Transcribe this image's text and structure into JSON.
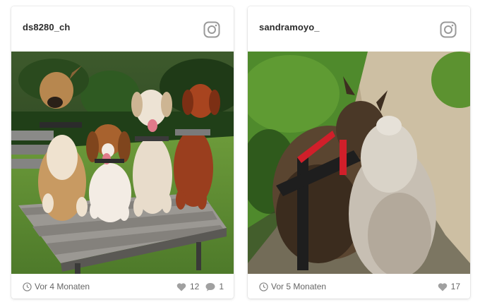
{
  "posts": [
    {
      "username": "ds8280_ch",
      "time_ago": "Vor 4 Monaten",
      "likes": "12",
      "comments": "1",
      "icons": [
        "instagram-icon",
        "clock-icon",
        "heart-icon",
        "comment-icon"
      ],
      "photo": "four dogs sitting on a wooden bench in a garden"
    },
    {
      "username": "sandramoyo_",
      "time_ago": "Vor 5 Monaten",
      "likes": "17",
      "icons": [
        "instagram-icon",
        "clock-icon",
        "heart-icon"
      ],
      "photo": "two dogs on a sunny path seen from above, one wearing a black and red harness"
    }
  ],
  "colors": {
    "text": "#2b2b2b",
    "meta": "#666666",
    "icon": "#9a9a9a"
  }
}
